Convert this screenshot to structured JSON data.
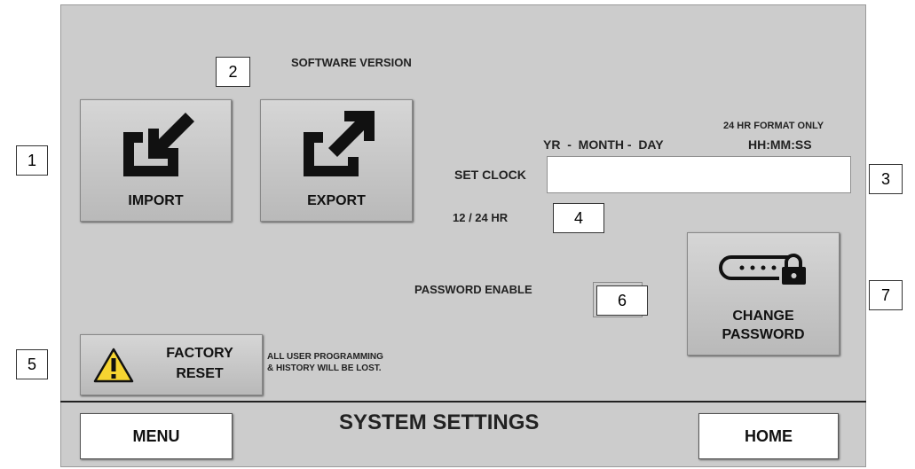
{
  "screen": {
    "title": "SYSTEM SETTINGS",
    "software_version_label": "SOFTWARE VERSION"
  },
  "buttons": {
    "import_label": "IMPORT",
    "export_label": "EXPORT",
    "change_password_line1": "CHANGE",
    "change_password_line2": "PASSWORD",
    "factory_reset_line1": "FACTORY",
    "factory_reset_line2": "RESET",
    "menu_label": "MENU",
    "home_label": "HOME"
  },
  "clock": {
    "format_note": "24 HR FORMAT ONLY",
    "date_format": "YR  -  MONTH -  DAY",
    "time_format": "HH:MM:SS",
    "set_clock_label": "SET CLOCK",
    "value": ""
  },
  "hour_mode_label": "12 / 24 HR",
  "password_enable_label": "PASSWORD ENABLE",
  "factory_reset_warning_line1": "ALL USER PROGRAMMING",
  "factory_reset_warning_line2": "& HISTORY WILL BE LOST.",
  "callouts": [
    "1",
    "2",
    "3",
    "4",
    "5",
    "6",
    "7"
  ],
  "icons": {
    "import": "import-arrow-icon",
    "export": "export-arrow-icon",
    "password": "password-lock-icon",
    "warning": "warning-triangle-icon"
  }
}
